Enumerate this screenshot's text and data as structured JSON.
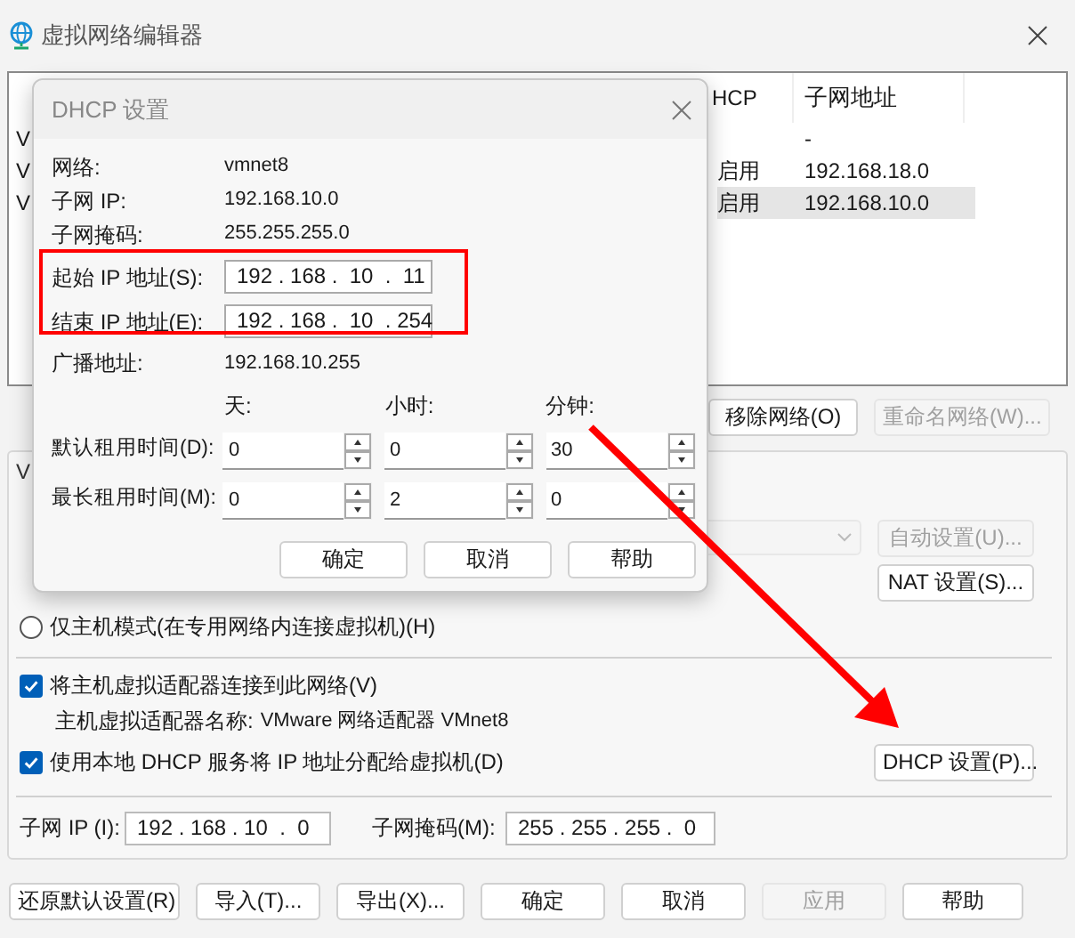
{
  "window": {
    "title": "虚拟网络编辑器"
  },
  "network_table": {
    "columns": [
      "HCP",
      "子网地址"
    ],
    "rows": [
      {
        "column_1": "V",
        "subnet": "-",
        "selected": false
      },
      {
        "column_1": "V",
        "dhcp": "启用",
        "subnet": "192.168.18.0",
        "selected": false
      },
      {
        "column_1": "V",
        "dhcp": "启用",
        "subnet": "192.168.10.0",
        "selected": true
      }
    ]
  },
  "group_label": "V",
  "table_buttons": [
    {
      "label": "移除网络(O)",
      "disabled": false
    },
    {
      "label": "重命名网络(W)...",
      "disabled": true
    }
  ],
  "nat_row": {
    "auto_button": {
      "label": "自动设置(U)...",
      "disabled": true
    },
    "nat_button": {
      "label": "NAT 设置(S)...",
      "disabled": false
    }
  },
  "host_only": {
    "label": "仅主机模式(在专用网络内连接虚拟机)(H)",
    "selected": false
  },
  "connect_adapter": {
    "label": "将主机虚拟适配器连接到此网络(V)",
    "checked": true
  },
  "adapter_name": {
    "label": "主机虚拟适配器名称:",
    "value": "VMware 网络适配器 VMnet8"
  },
  "use_dhcp": {
    "label": "使用本地 DHCP 服务将 IP 地址分配给虚拟机(D)",
    "checked": true
  },
  "dhcp_button": "DHCP 设置(P)...",
  "subnet_ip": {
    "label": "子网 IP (I):",
    "value": "192 . 168 . 10  .  0"
  },
  "subnet_mask": {
    "label": "子网掩码(M):",
    "value": "255 . 255 . 255 .  0"
  },
  "bottom_buttons": [
    {
      "label": "还原默认设置(R)",
      "disabled": false
    },
    {
      "label": "导入(T)...",
      "disabled": false
    },
    {
      "label": "导出(X)...",
      "disabled": false
    },
    {
      "label": "确定",
      "disabled": false
    },
    {
      "label": "取消",
      "disabled": false
    },
    {
      "label": "应用",
      "disabled": true
    },
    {
      "label": "帮助",
      "disabled": false
    }
  ],
  "dhcp_dialog": {
    "title": "DHCP 设置",
    "info": [
      {
        "label": "网络:",
        "value": "vmnet8"
      },
      {
        "label": "子网 IP:",
        "value": "192.168.10.0"
      },
      {
        "label": "子网掩码:",
        "value": "255.255.255.0"
      }
    ],
    "range": [
      {
        "label": "起始 IP 地址(S):",
        "value": "192 . 168 .  10  .  11"
      },
      {
        "label": "结束 IP 地址(E):",
        "value": "192 . 168 .  10  . 254"
      }
    ],
    "broadcast": {
      "label": "广播地址:",
      "value": "192.168.10.255"
    },
    "lease_headers": [
      "天:",
      "小时:",
      "分钟:"
    ],
    "lease_rows": [
      {
        "label": "默认租用时间(D):",
        "values": [
          "0",
          "0",
          "30"
        ]
      },
      {
        "label": "最长租用时间(M):",
        "values": [
          "0",
          "2",
          "0"
        ]
      }
    ],
    "buttons": [
      "确定",
      "取消",
      "帮助"
    ]
  },
  "annotations": {
    "highlight_box": {
      "color": "#ff0000"
    },
    "arrow": {
      "color": "#ff0000"
    }
  }
}
